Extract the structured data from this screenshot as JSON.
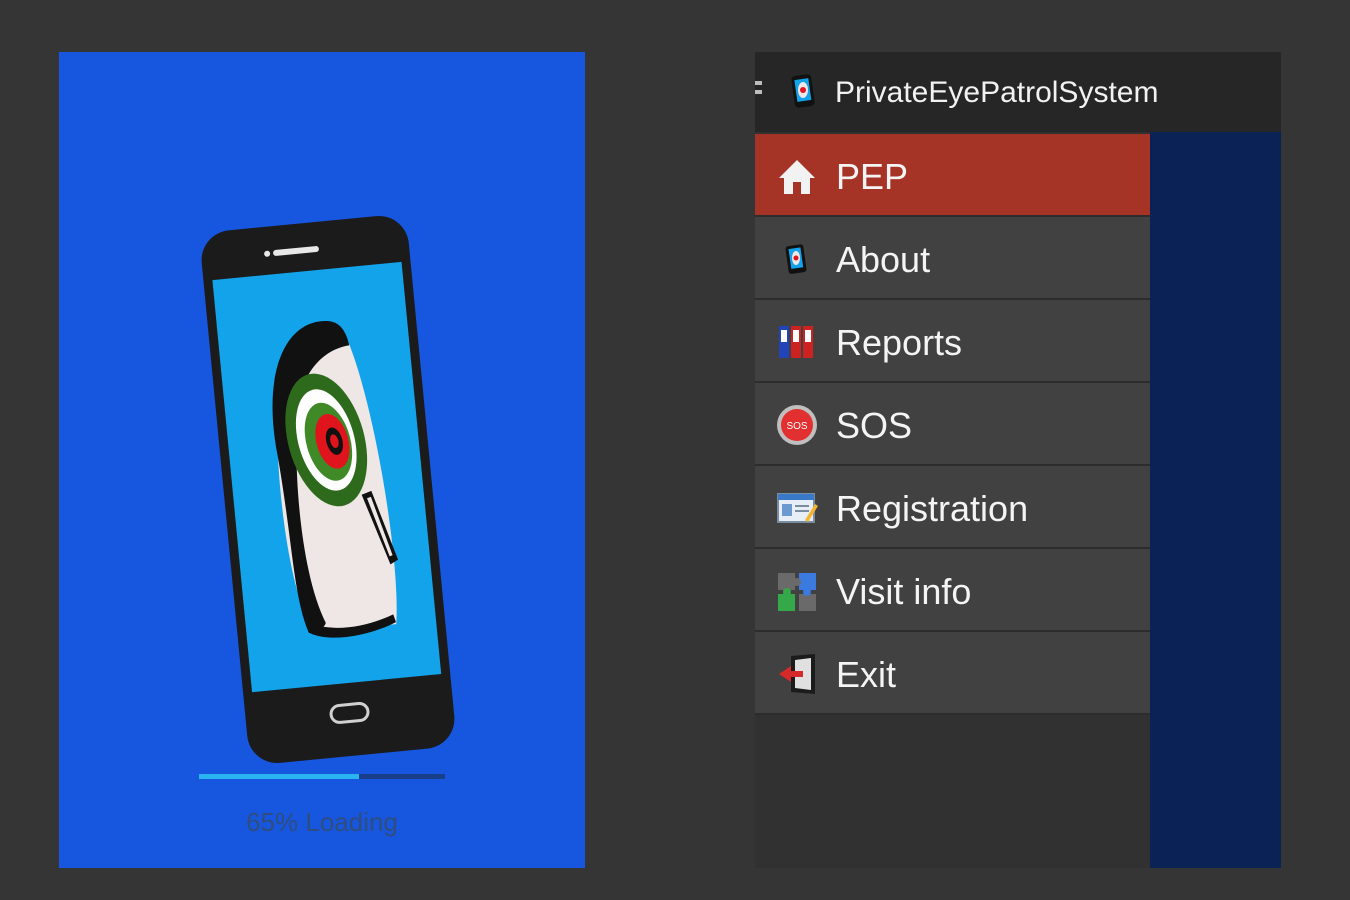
{
  "splash": {
    "loading_text": "65% Loading",
    "progress_fraction": 0.65,
    "logo_icon": "eye-magnifier-phone-logo",
    "colors": {
      "background": "#1756de",
      "phone_screen": "#13a3ea",
      "progress_fill": "#2ab4f2",
      "progress_track": "#1a3f8a"
    }
  },
  "app": {
    "title": "PrivateEyePatrolSystem",
    "title_icon": "pep-app-icon",
    "colors": {
      "actionbar": "#262626",
      "active_item": "#a63426",
      "item": "#414141",
      "backdrop": "#0a2255"
    },
    "menu": [
      {
        "label": "PEP",
        "icon": "home-icon",
        "active": true
      },
      {
        "label": "About",
        "icon": "pep-app-icon",
        "active": false
      },
      {
        "label": "Reports",
        "icon": "binders-icon",
        "active": false
      },
      {
        "label": "SOS",
        "icon": "sos-icon",
        "active": false
      },
      {
        "label": "Registration",
        "icon": "registration-form-icon",
        "active": false
      },
      {
        "label": "Visit info",
        "icon": "puzzle-icon",
        "active": false
      },
      {
        "label": "Exit",
        "icon": "exit-door-icon",
        "active": false
      }
    ]
  }
}
